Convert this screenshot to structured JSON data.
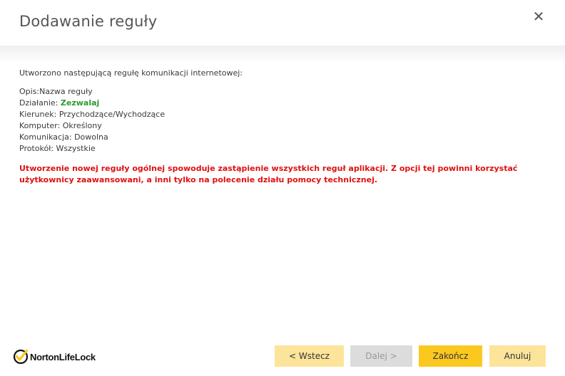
{
  "dialog": {
    "title": "Dodawanie reguły",
    "close_symbol": "✕"
  },
  "content": {
    "intro": "Utworzono następującą regułę komunikacji internetowej:",
    "rows": [
      {
        "label": "Opis:",
        "value": "Nazwa reguły"
      },
      {
        "label": "Działanie: ",
        "value": "Zezwalaj"
      },
      {
        "label": "Kierunek: ",
        "value": "Przychodzące/Wychodzące"
      },
      {
        "label": "Komputer: ",
        "value": "Określony"
      },
      {
        "label": "Komunikacja: ",
        "value": "Dowolna"
      },
      {
        "label": "Protokół: ",
        "value": "Wszystkie"
      }
    ],
    "warning": "Utworzenie nowej reguły ogólnej spowoduje zastąpienie wszystkich reguł aplikacji. Z opcji tej powinni korzystać użytkownicy zaawansowani, a inni tylko na polecenie działu pomocy technicznej."
  },
  "footer": {
    "brand": "NortonLifeLock",
    "buttons": {
      "back": "< Wstecz",
      "next": "Dalej >",
      "finish": "Zakończ",
      "cancel": "Anuluj"
    }
  },
  "colors": {
    "allow_green": "#2d9a2d",
    "warning_red": "#e01010",
    "button_yellow": "#fbc820",
    "button_light_yellow": "#fce49a",
    "button_disabled": "#dcdcdc",
    "brand_check_yellow": "#fbc820"
  },
  "icons": {
    "close": "close-icon",
    "brand": "norton-check-logo-icon"
  }
}
